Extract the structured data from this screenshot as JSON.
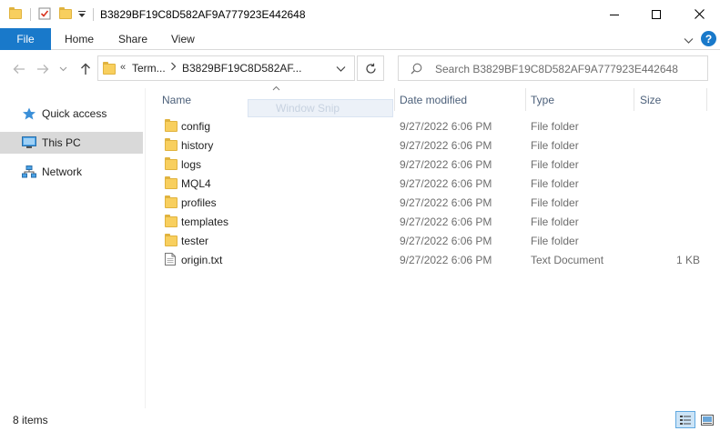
{
  "window": {
    "title": "B3829BF19C8D582AF9A777923E442648"
  },
  "ribbon": {
    "tabs": [
      "File",
      "Home",
      "Share",
      "View"
    ],
    "help_label": "?"
  },
  "address": {
    "overflow_chevron": "«",
    "crumbs": [
      "Term...",
      "B3829BF19C8D582AF..."
    ]
  },
  "search": {
    "placeholder": "Search B3829BF19C8D582AF9A777923E442648"
  },
  "nav_pane": {
    "items": [
      {
        "label": "Quick access",
        "icon": "star-icon",
        "selected": false
      },
      {
        "label": "This PC",
        "icon": "computer-icon",
        "selected": true
      },
      {
        "label": "Network",
        "icon": "network-icon",
        "selected": false
      }
    ]
  },
  "columns": [
    "Name",
    "Date modified",
    "Type",
    "Size"
  ],
  "files": [
    {
      "name": "config",
      "date": "9/27/2022 6:06 PM",
      "type": "File folder",
      "size": "",
      "icon": "folder-icon"
    },
    {
      "name": "history",
      "date": "9/27/2022 6:06 PM",
      "type": "File folder",
      "size": "",
      "icon": "folder-icon"
    },
    {
      "name": "logs",
      "date": "9/27/2022 6:06 PM",
      "type": "File folder",
      "size": "",
      "icon": "folder-icon"
    },
    {
      "name": "MQL4",
      "date": "9/27/2022 6:06 PM",
      "type": "File folder",
      "size": "",
      "icon": "folder-icon"
    },
    {
      "name": "profiles",
      "date": "9/27/2022 6:06 PM",
      "type": "File folder",
      "size": "",
      "icon": "folder-icon"
    },
    {
      "name": "templates",
      "date": "9/27/2022 6:06 PM",
      "type": "File folder",
      "size": "",
      "icon": "folder-icon"
    },
    {
      "name": "tester",
      "date": "9/27/2022 6:06 PM",
      "type": "File folder",
      "size": "",
      "icon": "folder-icon"
    },
    {
      "name": "origin.txt",
      "date": "9/27/2022 6:06 PM",
      "type": "Text Document",
      "size": "1 KB",
      "icon": "text-file-icon"
    }
  ],
  "drag_ghost": {
    "label": "Window Snip"
  },
  "status": {
    "item_count": "8 items"
  },
  "colors": {
    "accent": "#1979ca",
    "folder": "#f8cf5e",
    "selection": "#d9d9d9",
    "header_text": "#4c607a"
  }
}
